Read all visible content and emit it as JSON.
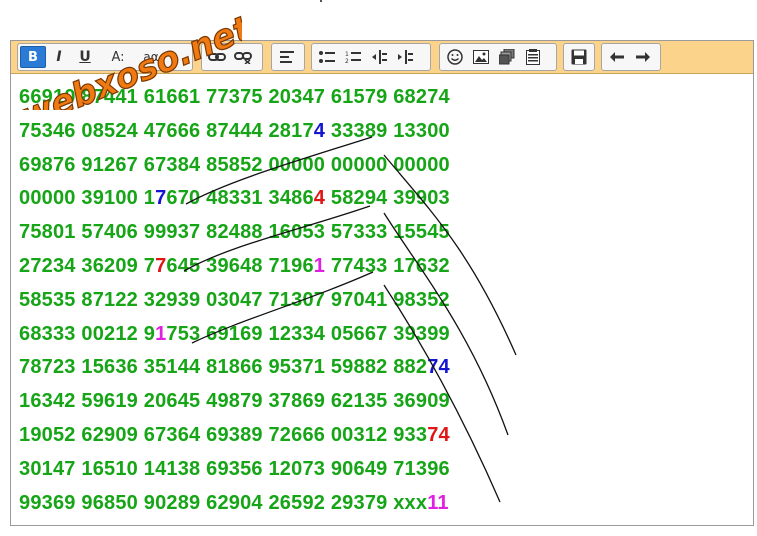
{
  "watermark": {
    "text": "webxoso.net"
  },
  "toolbar": {
    "buttons": [
      {
        "name": "bold-button",
        "glyph": "B",
        "icon": "bold-icon",
        "active": true
      },
      {
        "name": "italic-button",
        "glyph": "I",
        "icon": "italic-icon"
      },
      {
        "name": "underline-button",
        "glyph": "U",
        "icon": "underline-icon"
      },
      {
        "name": "font-size-button",
        "glyph": "A:",
        "icon": "font-size-icon"
      },
      {
        "name": "case-button",
        "glyph": "aα",
        "icon": "case-icon"
      },
      {
        "name": "link-button",
        "icon": "link-icon"
      },
      {
        "name": "unlink-button",
        "icon": "unlink-icon"
      },
      {
        "name": "align-left-button",
        "icon": "align-left-icon"
      },
      {
        "name": "bullet-list-button",
        "icon": "bullet-list-icon"
      },
      {
        "name": "numbered-list-button",
        "icon": "numbered-list-icon"
      },
      {
        "name": "outdent-button",
        "icon": "outdent-icon"
      },
      {
        "name": "indent-button",
        "icon": "indent-icon"
      },
      {
        "name": "emoji-button",
        "icon": "smiley-icon"
      },
      {
        "name": "image-button",
        "icon": "image-icon"
      },
      {
        "name": "gallery-button",
        "icon": "gallery-icon"
      },
      {
        "name": "paste-button",
        "icon": "paste-icon"
      },
      {
        "name": "save-button",
        "icon": "save-icon"
      },
      {
        "name": "undo-button",
        "icon": "undo-icon"
      },
      {
        "name": "redo-button",
        "icon": "redo-icon"
      }
    ]
  },
  "colors": {
    "numbers": "#16a516",
    "blue": "#1414d2",
    "red": "#e01616",
    "magenta": "#e020e0",
    "toolbar": "#fcd38a"
  },
  "rows": [
    [
      {
        "t": "66910 87441 61661 77375 20347 61579 68274"
      }
    ],
    [
      {
        "t": "75346 08524 47666 87444 2817"
      },
      {
        "t": "4",
        "c": "blue"
      },
      {
        "t": " 33389 13300"
      }
    ],
    [
      {
        "t": "69876 91267 67384 85852 00000 00000 00000"
      }
    ],
    [
      {
        "t": "00000 39100 1"
      },
      {
        "t": "7",
        "c": "blue"
      },
      {
        "t": "670 48331 3486"
      },
      {
        "t": "4",
        "c": "red"
      },
      {
        "t": " 58294 39903"
      }
    ],
    [
      {
        "t": "75801 57406 99937 82488 16053 57333 15545"
      }
    ],
    [
      {
        "t": "27234 36209 7"
      },
      {
        "t": "7",
        "c": "red"
      },
      {
        "t": "645 39648 7196"
      },
      {
        "t": "1",
        "c": "magenta"
      },
      {
        "t": " 77433 17632"
      }
    ],
    [
      {
        "t": "58535 87122 32939 03047 71307 97041 98352"
      }
    ],
    [
      {
        "t": "68333 00212 9"
      },
      {
        "t": "1",
        "c": "magenta"
      },
      {
        "t": "753 69169 12334 05667 39399"
      }
    ],
    [
      {
        "t": "78723 15636 35144 81866 95371 59882 882"
      },
      {
        "t": "74",
        "c": "blue"
      }
    ],
    [
      {
        "t": "16342 59619 20645 49879 37869 62135 36909"
      }
    ],
    [
      {
        "t": "19052 62909 67364 69389 72666 00312 933"
      },
      {
        "t": "74",
        "c": "red"
      }
    ],
    [
      {
        "t": "30147 16510 14138 69356 12073 90649 71396"
      }
    ],
    [
      {
        "t": "99369 96850 90289 62904 26592 29379 xxx"
      },
      {
        "t": "11",
        "c": "magenta"
      }
    ]
  ]
}
